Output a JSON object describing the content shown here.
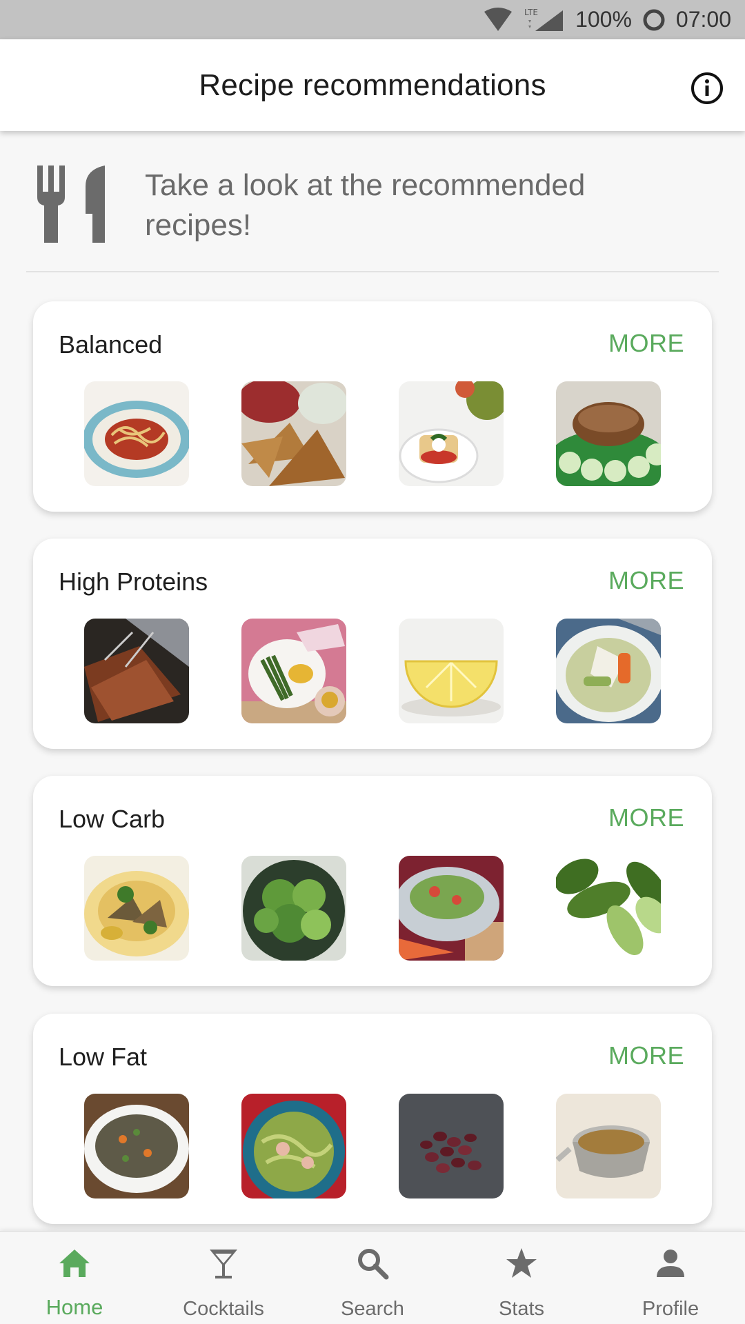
{
  "status_bar": {
    "battery": "100%",
    "time": "07:00",
    "network": "LTE"
  },
  "app_bar": {
    "title": "Recipe recommendations"
  },
  "intro": {
    "text": "Take a look at the recommended recipes!"
  },
  "colors": {
    "accent": "#5aaa5d",
    "more": "#5aaa5d"
  },
  "categories": [
    {
      "title": "Balanced",
      "more": "MORE",
      "images": [
        "spaghetti-bowl",
        "pita-chips-salsa",
        "tomato-mozzarella-toast",
        "dip-with-cucumber"
      ]
    },
    {
      "title": "High Proteins",
      "more": "MORE",
      "images": [
        "grilled-skewers",
        "asparagus-plate",
        "lemon-half",
        "chicken-vegetable-soup"
      ]
    },
    {
      "title": "Low Carb",
      "more": "MORE",
      "images": [
        "chicken-plate",
        "green-salad",
        "salad-glass-bowl",
        "cucumbers"
      ]
    },
    {
      "title": "Low Fat",
      "more": "MORE",
      "images": [
        "lentil-bowl",
        "noodle-salad",
        "red-beans",
        "lentils-measuring-cup"
      ]
    }
  ],
  "bottom_nav": {
    "items": [
      {
        "label": "Home",
        "icon": "home-icon",
        "active": true
      },
      {
        "label": "Cocktails",
        "icon": "cocktail-icon",
        "active": false
      },
      {
        "label": "Search",
        "icon": "search-icon",
        "active": false
      },
      {
        "label": "Stats",
        "icon": "star-icon",
        "active": false
      },
      {
        "label": "Profile",
        "icon": "person-icon",
        "active": false
      }
    ]
  }
}
